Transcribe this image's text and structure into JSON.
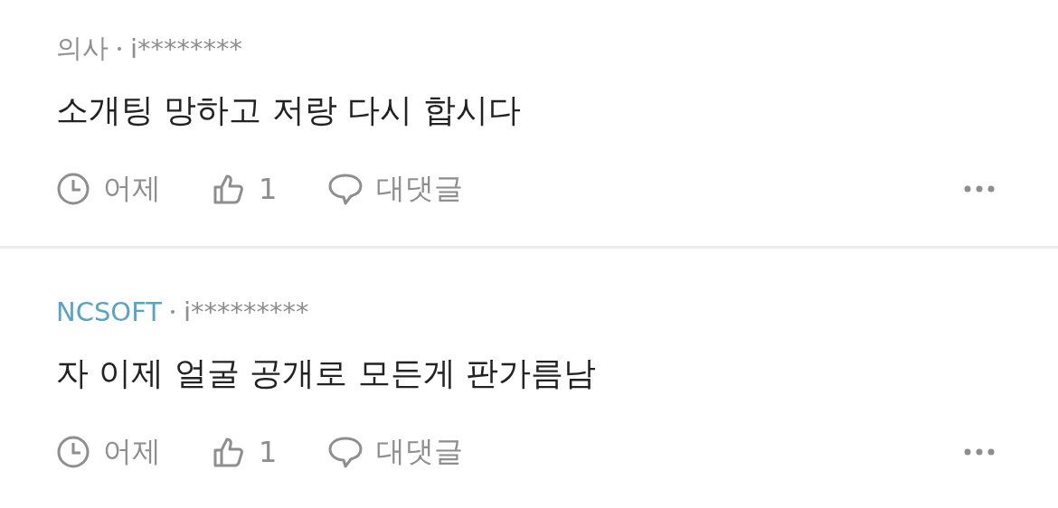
{
  "comments": [
    {
      "author": "의사",
      "color": "#8e8e8e",
      "user": "i********",
      "text": "소개팅 망하고 저랑 다시 합시다",
      "time": "어제",
      "likes": "1",
      "reply": "대댓글"
    },
    {
      "author": "NCSOFT",
      "color": "#5aa5bd",
      "user": "i*********",
      "text": "자 이제 얼굴 공개로 모든게 판가름남",
      "time": "어제",
      "likes": "1",
      "reply": "대댓글"
    }
  ]
}
